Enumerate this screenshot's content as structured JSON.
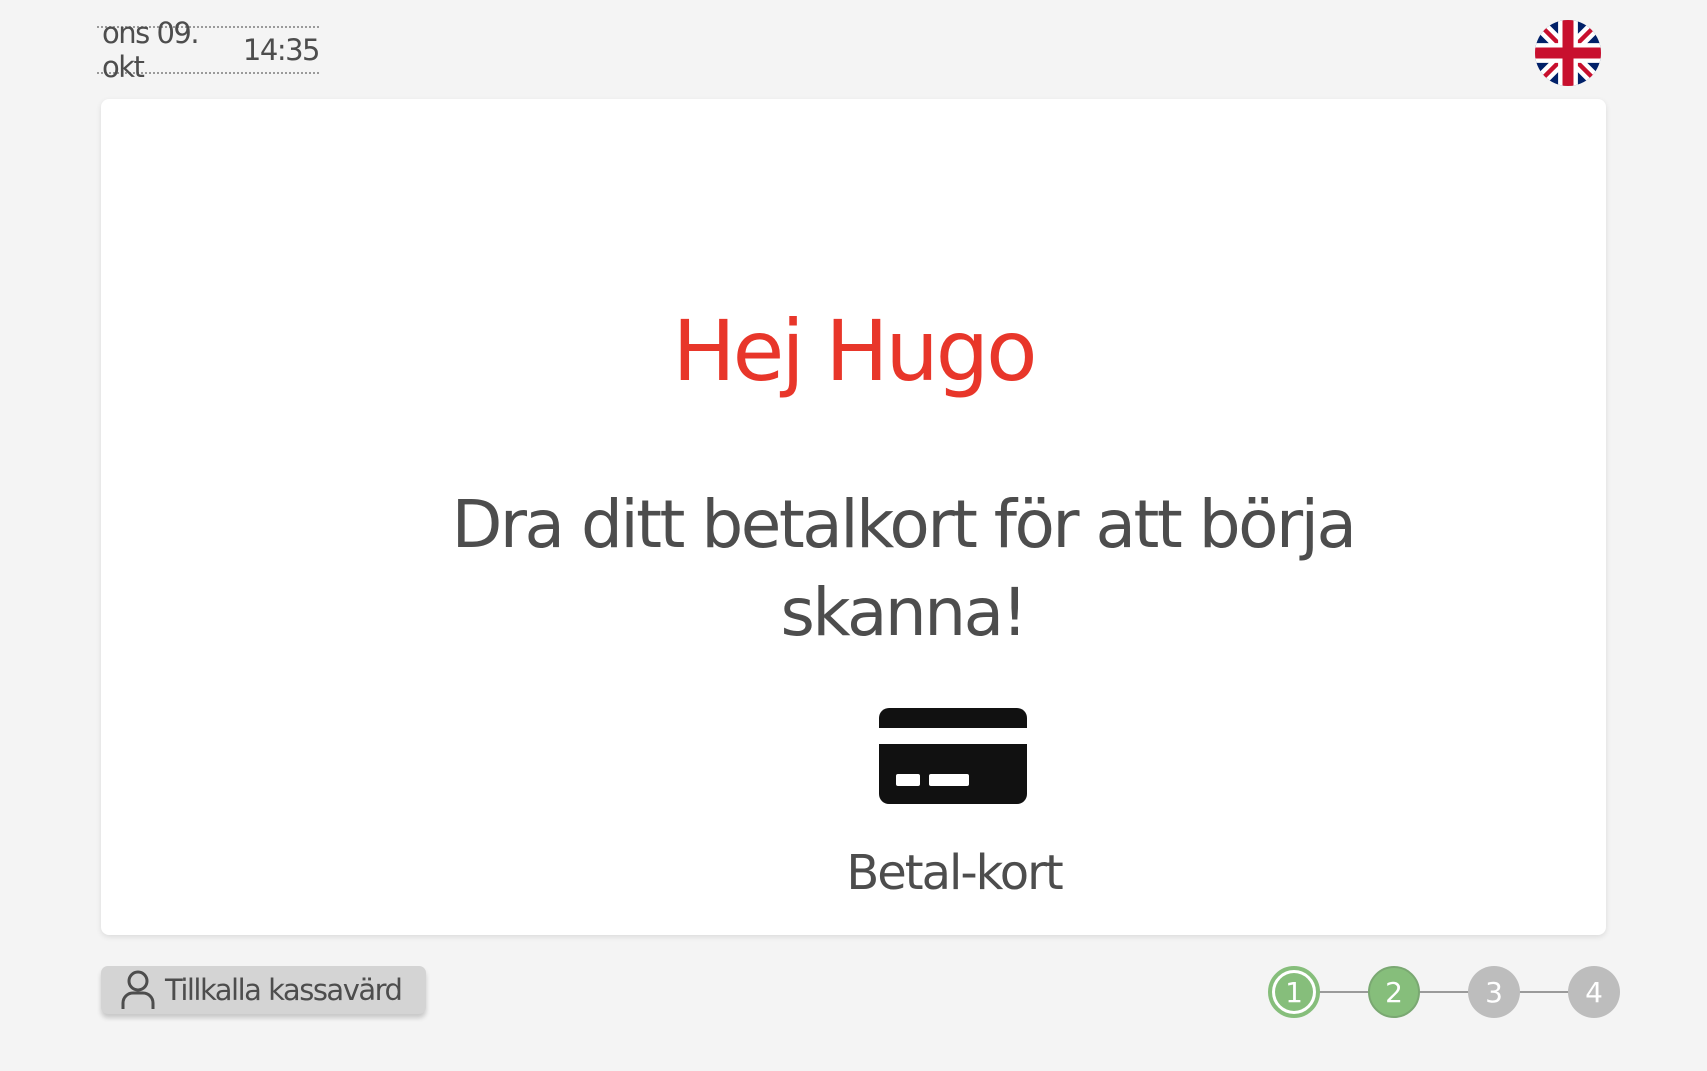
{
  "header": {
    "date": "ons 09. okt",
    "time": "14:35",
    "language_icon": "uk-flag-icon"
  },
  "main": {
    "greeting": "Hej Hugo",
    "instruction": "Dra ditt betalkort för att börja skanna!",
    "payment_icon": "credit-card-icon",
    "payment_label": "Betal-kort"
  },
  "footer": {
    "assist_icon": "person-icon",
    "assist_label": "Tillkalla kassavärd",
    "steps": [
      "1",
      "2",
      "3",
      "4"
    ],
    "current_step": 2
  },
  "colors": {
    "accent": "#e8362a",
    "step_active": "#86be7b",
    "step_pending": "#bdbdbd",
    "text": "#4d4d4d",
    "background": "#f4f4f4"
  }
}
